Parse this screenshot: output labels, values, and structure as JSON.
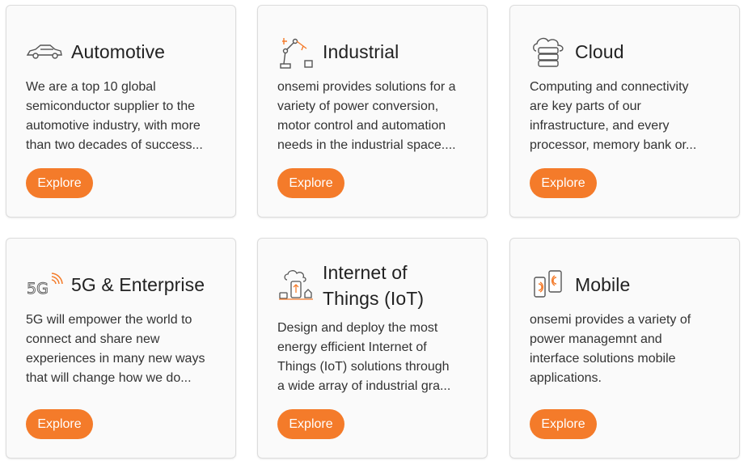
{
  "colors": {
    "accent": "#f47b2a",
    "card_bg": "#fafafa",
    "border": "#dcdcdc"
  },
  "cards": [
    {
      "icon": "car-icon",
      "title": "Automotive",
      "lines": [
        "We are a top 10 global",
        "semiconductor supplier to the",
        "automotive industry, with more",
        "than two decades of success..."
      ],
      "button": "Explore"
    },
    {
      "icon": "robot-arm-icon",
      "title": "Industrial",
      "lines": [
        "onsemi provides solutions for a",
        "variety of power conversion,",
        "motor control and automation",
        "needs in the industrial space...."
      ],
      "button": "Explore"
    },
    {
      "icon": "cloud-server-icon",
      "title": "Cloud",
      "lines": [
        "Computing and connectivity",
        "are key parts of our",
        "infrastructure, and every",
        "processor, memory bank or..."
      ],
      "button": "Explore"
    },
    {
      "icon": "5g-signal-icon",
      "title": "5G & Enterprise",
      "lines": [
        "5G will empower the world to",
        "connect and share new",
        "experiences in many new ways",
        "that will change how we do..."
      ],
      "button": "Explore"
    },
    {
      "icon": "iot-devices-icon",
      "title_lines": [
        "Internet of",
        "Things (IoT)"
      ],
      "lines": [
        "Design and deploy the most",
        "energy efficient Internet of",
        "Things (IoT) solutions through",
        "a wide array of industrial gra..."
      ],
      "button": "Explore"
    },
    {
      "icon": "mobile-devices-icon",
      "title": "Mobile",
      "lines": [
        "onsemi provides a variety of",
        "power managemnt and",
        "interface solutions mobile",
        "applications."
      ],
      "button": "Explore"
    }
  ]
}
